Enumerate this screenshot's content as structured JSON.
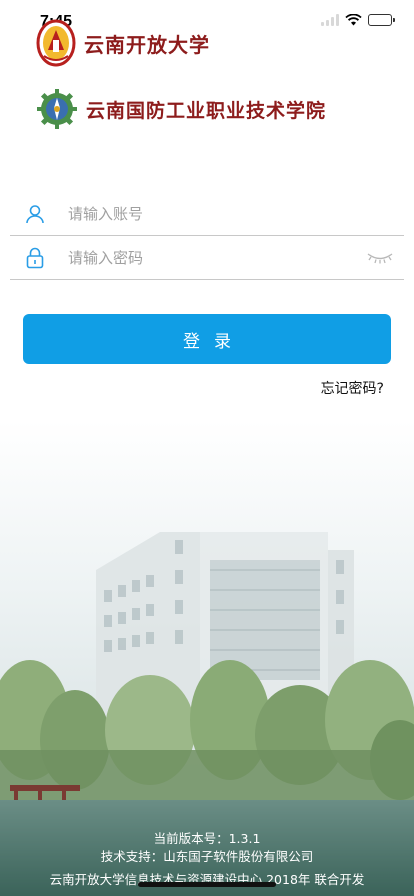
{
  "status_bar": {
    "time": "7:45"
  },
  "logos": {
    "primary": "云南开放大学",
    "secondary": "云南国防工业职业技术学院"
  },
  "form": {
    "account_placeholder": "请输入账号",
    "account_value": "",
    "password_placeholder": "请输入密码",
    "password_value": ""
  },
  "actions": {
    "login_label": "登录",
    "forgot_label": "忘记密码?"
  },
  "footer": {
    "version": "当前版本号：1.3.1",
    "tech_support": "技术支持：山东国子软件股份有限公司",
    "developer": "云南开放大学信息技术与资源建设中心 2018年 联合开发"
  },
  "colors": {
    "accent": "#109ee5",
    "logo_red": "#8d1c1c",
    "icon_blue": "#2a9de6"
  }
}
